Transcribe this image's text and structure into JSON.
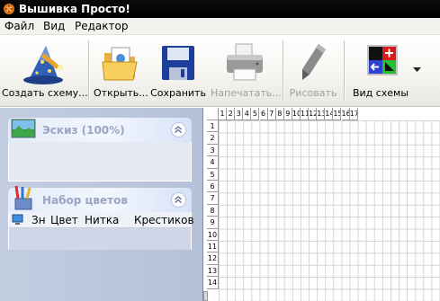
{
  "window": {
    "title": "Вышивка Просто!"
  },
  "menu": {
    "items": [
      "Файл",
      "Вид",
      "Редактор"
    ]
  },
  "toolbar": {
    "create_label": "Создать схему...",
    "open_label": "Открыть...",
    "save_label": "Сохранить",
    "print_label": "Напечатать...",
    "draw_label": "Рисовать",
    "view_label": "Вид схемы"
  },
  "sketch_panel": {
    "title": "Эскиз (100%)"
  },
  "colors_panel": {
    "title": "Набор цветов",
    "columns": [
      "Зн",
      "Цвет",
      "Нитка",
      "Крестиков"
    ]
  },
  "grid": {
    "col_numbers": [
      "1",
      "2",
      "3",
      "4",
      "5",
      "6",
      "7",
      "8",
      "9",
      "10",
      "11",
      "12",
      "13",
      "14",
      "15",
      "16",
      "17"
    ],
    "row_numbers": [
      "1",
      "2",
      "3",
      "4",
      "5",
      "6",
      "7",
      "8",
      "9",
      "10",
      "11",
      "12",
      "13",
      "14"
    ]
  }
}
